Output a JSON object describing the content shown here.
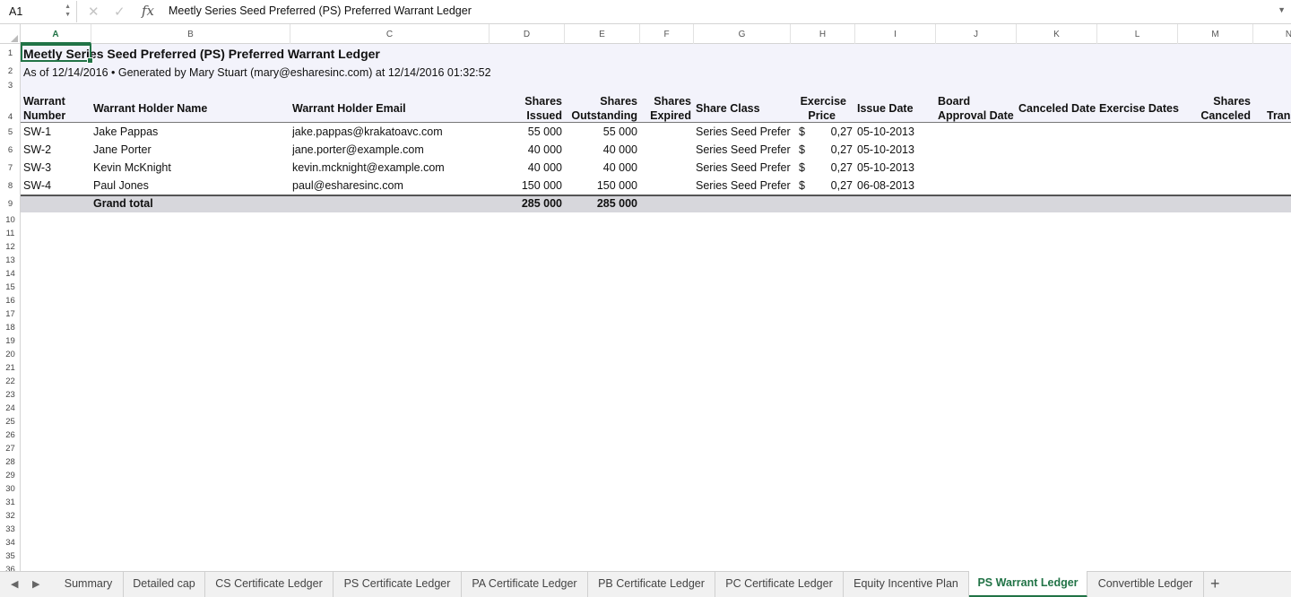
{
  "formula_bar": {
    "name_box": "A1",
    "formula": "Meetly Series Seed Preferred (PS) Preferred Warrant Ledger",
    "cancel_icon": "close-icon",
    "confirm_icon": "check-icon",
    "fx_label": "fx"
  },
  "columns": [
    "A",
    "B",
    "C",
    "D",
    "E",
    "F",
    "G",
    "H",
    "I",
    "J",
    "K",
    "L",
    "M",
    "N"
  ],
  "rows": [
    "1",
    "2",
    "3",
    "4",
    "5",
    "6",
    "7",
    "8",
    "9",
    "10",
    "11",
    "12",
    "13",
    "14",
    "15",
    "16",
    "17",
    "18",
    "19",
    "20",
    "21",
    "22",
    "23",
    "24",
    "25",
    "26",
    "27",
    "28",
    "29",
    "30",
    "31",
    "32",
    "33",
    "34",
    "35",
    "36"
  ],
  "sheet": {
    "title": "Meetly Series Seed Preferred (PS) Preferred Warrant Ledger",
    "subtitle": "As of 12/14/2016 • Generated by Mary Stuart (mary@esharesinc.com) at 12/14/2016 01:32:52",
    "headers": {
      "warrant_number": [
        "Warrant",
        "Number"
      ],
      "holder_name": "Warrant Holder Name",
      "holder_email": "Warrant Holder Email",
      "shares_issued": [
        "Shares",
        "Issued"
      ],
      "shares_outstanding": [
        "Shares",
        "Outstanding"
      ],
      "shares_expired": [
        "Shares",
        "Expired"
      ],
      "share_class": "Share Class",
      "exercise_price": [
        "Exercise",
        "Price"
      ],
      "issue_date": "Issue Date",
      "board_approval_date": [
        "Board",
        "Approval Date"
      ],
      "canceled_date": "Canceled Date",
      "exercise_dates": "Exercise Dates",
      "shares_canceled": [
        "Shares",
        "Canceled"
      ],
      "shares_transferred": "Trans"
    },
    "records": [
      {
        "number": "SW-1",
        "name": "Jake Pappas",
        "email": "jake.pappas@krakatoavc.com",
        "issued": "55 000",
        "outstanding": "55 000",
        "share_class": "Series Seed Preferr",
        "currency": "$",
        "price": "0,27",
        "issue_date": "05-10-2013"
      },
      {
        "number": "SW-2",
        "name": "Jane Porter",
        "email": "jane.porter@example.com",
        "issued": "40 000",
        "outstanding": "40 000",
        "share_class": "Series Seed Preferr",
        "currency": "$",
        "price": "0,27",
        "issue_date": "05-10-2013"
      },
      {
        "number": "SW-3",
        "name": "Kevin McKnight",
        "email": "kevin.mcknight@example.com",
        "issued": "40 000",
        "outstanding": "40 000",
        "share_class": "Series Seed Preferr",
        "currency": "$",
        "price": "0,27",
        "issue_date": "05-10-2013"
      },
      {
        "number": "SW-4",
        "name": "Paul Jones",
        "email": "paul@esharesinc.com",
        "issued": "150 000",
        "outstanding": "150 000",
        "share_class": "Series Seed Preferr",
        "currency": "$",
        "price": "0,27",
        "issue_date": "06-08-2013"
      }
    ],
    "total": {
      "label": "Grand total",
      "issued": "285 000",
      "outstanding": "285 000"
    }
  },
  "tabs": {
    "items": [
      "Summary",
      "Detailed cap",
      "CS Certificate Ledger",
      "PS Certificate Ledger",
      "PA Certificate Ledger",
      "PB Certificate Ledger",
      "PC Certificate Ledger",
      "Equity Incentive Plan",
      "PS Warrant Ledger",
      "Convertible Ledger"
    ],
    "active": "PS Warrant Ledger",
    "add_label": "+",
    "prev_icon": "triangle-left-icon",
    "next_icon": "triangle-right-icon"
  },
  "colors": {
    "accent": "#217346",
    "header_band": "#f3f3fb",
    "total_band": "#d7d7dc"
  }
}
